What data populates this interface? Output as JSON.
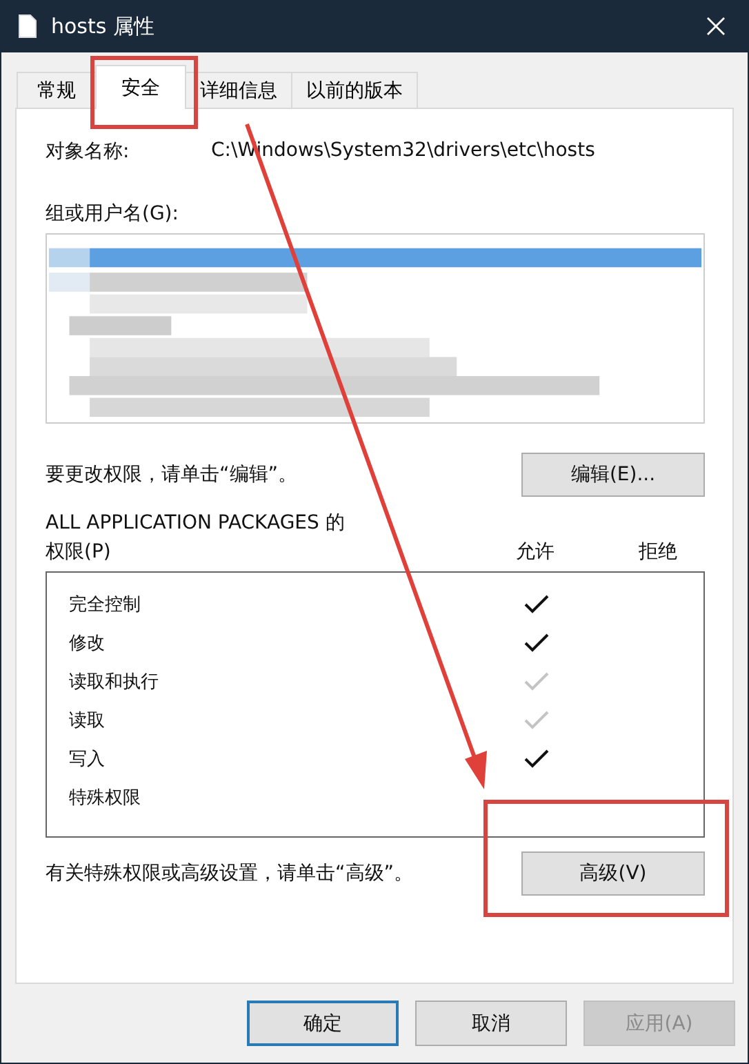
{
  "window": {
    "title": "hosts 属性"
  },
  "tabs": [
    {
      "label": "常规",
      "selected": false
    },
    {
      "label": "安全",
      "selected": true
    },
    {
      "label": "详细信息",
      "selected": false
    },
    {
      "label": "以前的版本",
      "selected": false
    }
  ],
  "object_name": {
    "label": "对象名称:",
    "value": "C:\\Windows\\System32\\drivers\\etc\\hosts"
  },
  "group_label": "组或用户名(G):",
  "users_list": {
    "kind": "blurred"
  },
  "edit_hint": "要更改权限，请单击“编辑”。",
  "edit_button": "编辑(E)...",
  "permissions_for": "ALL APPLICATION PACKAGES 的",
  "permissions_label": "权限(P)",
  "columns": [
    "允许",
    "拒绝"
  ],
  "permissions": [
    {
      "name": "完全控制",
      "allowed": true,
      "inherited": false
    },
    {
      "name": "修改",
      "allowed": true,
      "inherited": false
    },
    {
      "name": "读取和执行",
      "allowed": true,
      "inherited": true
    },
    {
      "name": "读取",
      "allowed": true,
      "inherited": true
    },
    {
      "name": "写入",
      "allowed": true,
      "inherited": false
    },
    {
      "name": "特殊权限",
      "allowed": false
    }
  ],
  "advanced_hint": "有关特殊权限或高级设置，请单击“高级”。",
  "advanced_button": "高级(V)",
  "buttons": [
    {
      "label": "确定",
      "kind": "default",
      "disabled": false
    },
    {
      "label": "取消",
      "kind": "normal",
      "disabled": false
    },
    {
      "label": "应用(A)",
      "kind": "normal",
      "disabled": true
    }
  ],
  "annotations": [
    {
      "kind": "box"
    },
    {
      "kind": "arrow"
    },
    {
      "kind": "box"
    }
  ]
}
